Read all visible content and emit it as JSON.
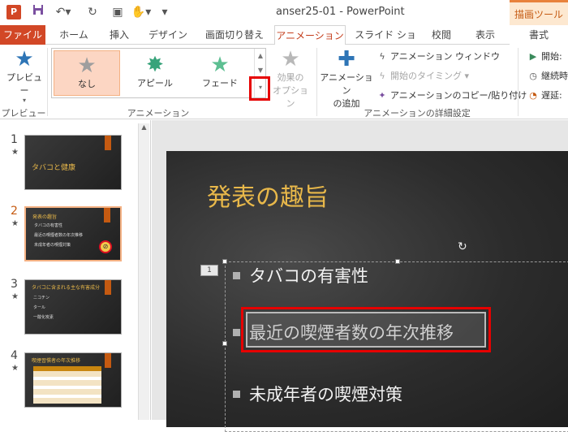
{
  "titlebar": {
    "app_icon": "P",
    "title": "anser25-01 - PowerPoint",
    "tool_tab_title": "描画ツール",
    "qat": {
      "save_icon": "save-icon",
      "undo_icon": "undo-icon",
      "redo_icon": "redo-icon",
      "present_icon": "present-icon",
      "touch_icon": "touch-icon",
      "customize_icon": "customize-icon"
    }
  },
  "tabs": [
    {
      "label": "ファイル"
    },
    {
      "label": "ホーム"
    },
    {
      "label": "挿入"
    },
    {
      "label": "デザイン"
    },
    {
      "label": "画面切り替え"
    },
    {
      "label": "アニメーション"
    },
    {
      "label": "スライド ショー"
    },
    {
      "label": "校閲"
    },
    {
      "label": "表示"
    },
    {
      "label": "書式"
    }
  ],
  "ribbon": {
    "preview": {
      "label": "プレビュー",
      "group": "プレビュー"
    },
    "gallery": {
      "items": [
        {
          "label": "なし"
        },
        {
          "label": "アピール"
        },
        {
          "label": "フェード"
        }
      ],
      "group": "アニメーション"
    },
    "effect_options": {
      "line1": "効果の",
      "line2": "オプション"
    },
    "add_animation": {
      "line1": "アニメーション",
      "line2": "の追加"
    },
    "animation_window": "アニメーション ウィンドウ",
    "trigger_timing": "開始のタイミング",
    "animation_painter": "アニメーションのコピー/貼り付け",
    "advanced_group": "アニメーションの詳細設定",
    "start": "開始:",
    "duration": "継続時",
    "delay": "遅延:"
  },
  "slides": [
    {
      "num": "1",
      "title": "タバコと健康",
      "lines": []
    },
    {
      "num": "2",
      "title": "発表の趣旨",
      "lines": [
        "タバコの有害性",
        "最近の喫煙者数の年次推移",
        "未成年者の喫煙対策"
      ]
    },
    {
      "num": "3",
      "title": "タバコに含まれる主な有害成分",
      "lines": [
        "ニコチン",
        "タール",
        "一酸化炭素"
      ]
    },
    {
      "num": "4",
      "title": "喫煙習慣者の年次推移",
      "lines": []
    }
  ],
  "main_slide": {
    "title": "発表の趣旨",
    "anim_tag": "1",
    "bullets": [
      "タバコの有害性",
      "最近の喫煙者数の年次推移",
      "未成年者の喫煙対策"
    ]
  }
}
